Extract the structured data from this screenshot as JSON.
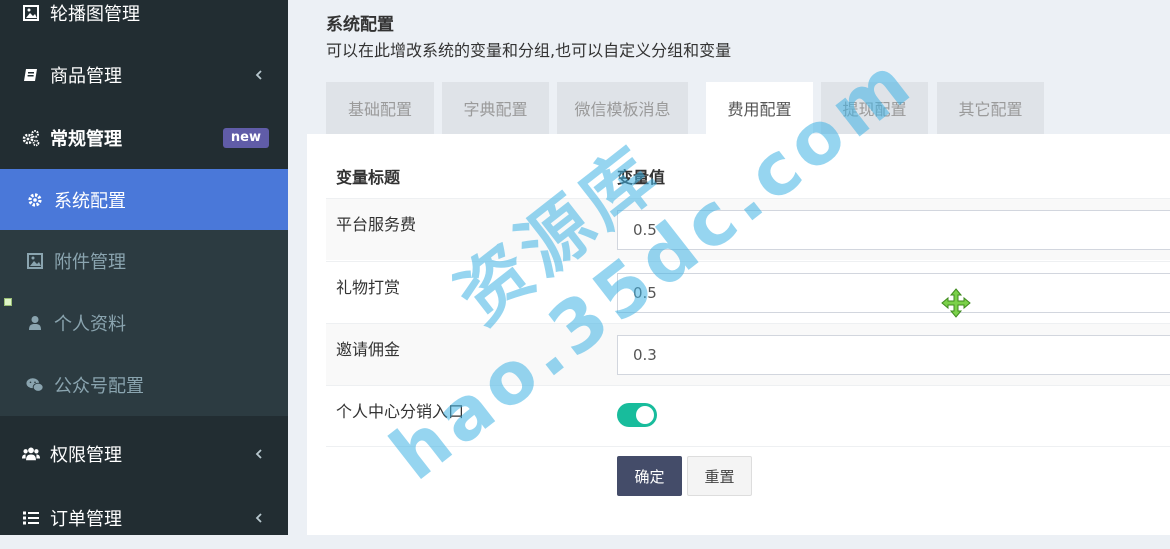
{
  "sidebar": {
    "items": [
      {
        "label": "轮播图管理",
        "icon": "image-icon"
      },
      {
        "label": "商品管理",
        "icon": "book-icon"
      },
      {
        "label": "常规管理",
        "icon": "cogs-icon",
        "badge": "new"
      },
      {
        "label": "系统配置",
        "icon": "gear-icon"
      },
      {
        "label": "附件管理",
        "icon": "image-icon"
      },
      {
        "label": "个人资料",
        "icon": "user-icon"
      },
      {
        "label": "公众号配置",
        "icon": "wechat-icon"
      },
      {
        "label": "权限管理",
        "icon": "users-icon"
      },
      {
        "label": "订单管理",
        "icon": "list-icon"
      }
    ]
  },
  "header": {
    "title": "系统配置",
    "subtitle": "可以在此增改系统的变量和分组,也可以自定义分组和变量"
  },
  "tabs": [
    {
      "label": "基础配置"
    },
    {
      "label": "字典配置"
    },
    {
      "label": "微信模板消息"
    },
    {
      "label": "费用配置",
      "active": true
    },
    {
      "label": "提现配置"
    },
    {
      "label": "其它配置"
    }
  ],
  "table": {
    "col_title": "变量标题",
    "col_value": "变量值",
    "rows": [
      {
        "label": "平台服务费",
        "value": "0.5"
      },
      {
        "label": "礼物打赏",
        "value": "0.5"
      },
      {
        "label": "邀请佣金",
        "value": "0.3"
      },
      {
        "label": "个人中心分销入口",
        "toggle": true
      }
    ]
  },
  "buttons": {
    "submit": "确定",
    "reset": "重置"
  },
  "watermark": {
    "line1": "资源库",
    "line2": "hao.35dc.com"
  },
  "colors": {
    "sidebar_bg": "#222d32",
    "active_nav": "#4a78d9",
    "badge_new": "#605ca8",
    "toggle_on": "#18bc9c",
    "primary_button": "#444c69"
  }
}
